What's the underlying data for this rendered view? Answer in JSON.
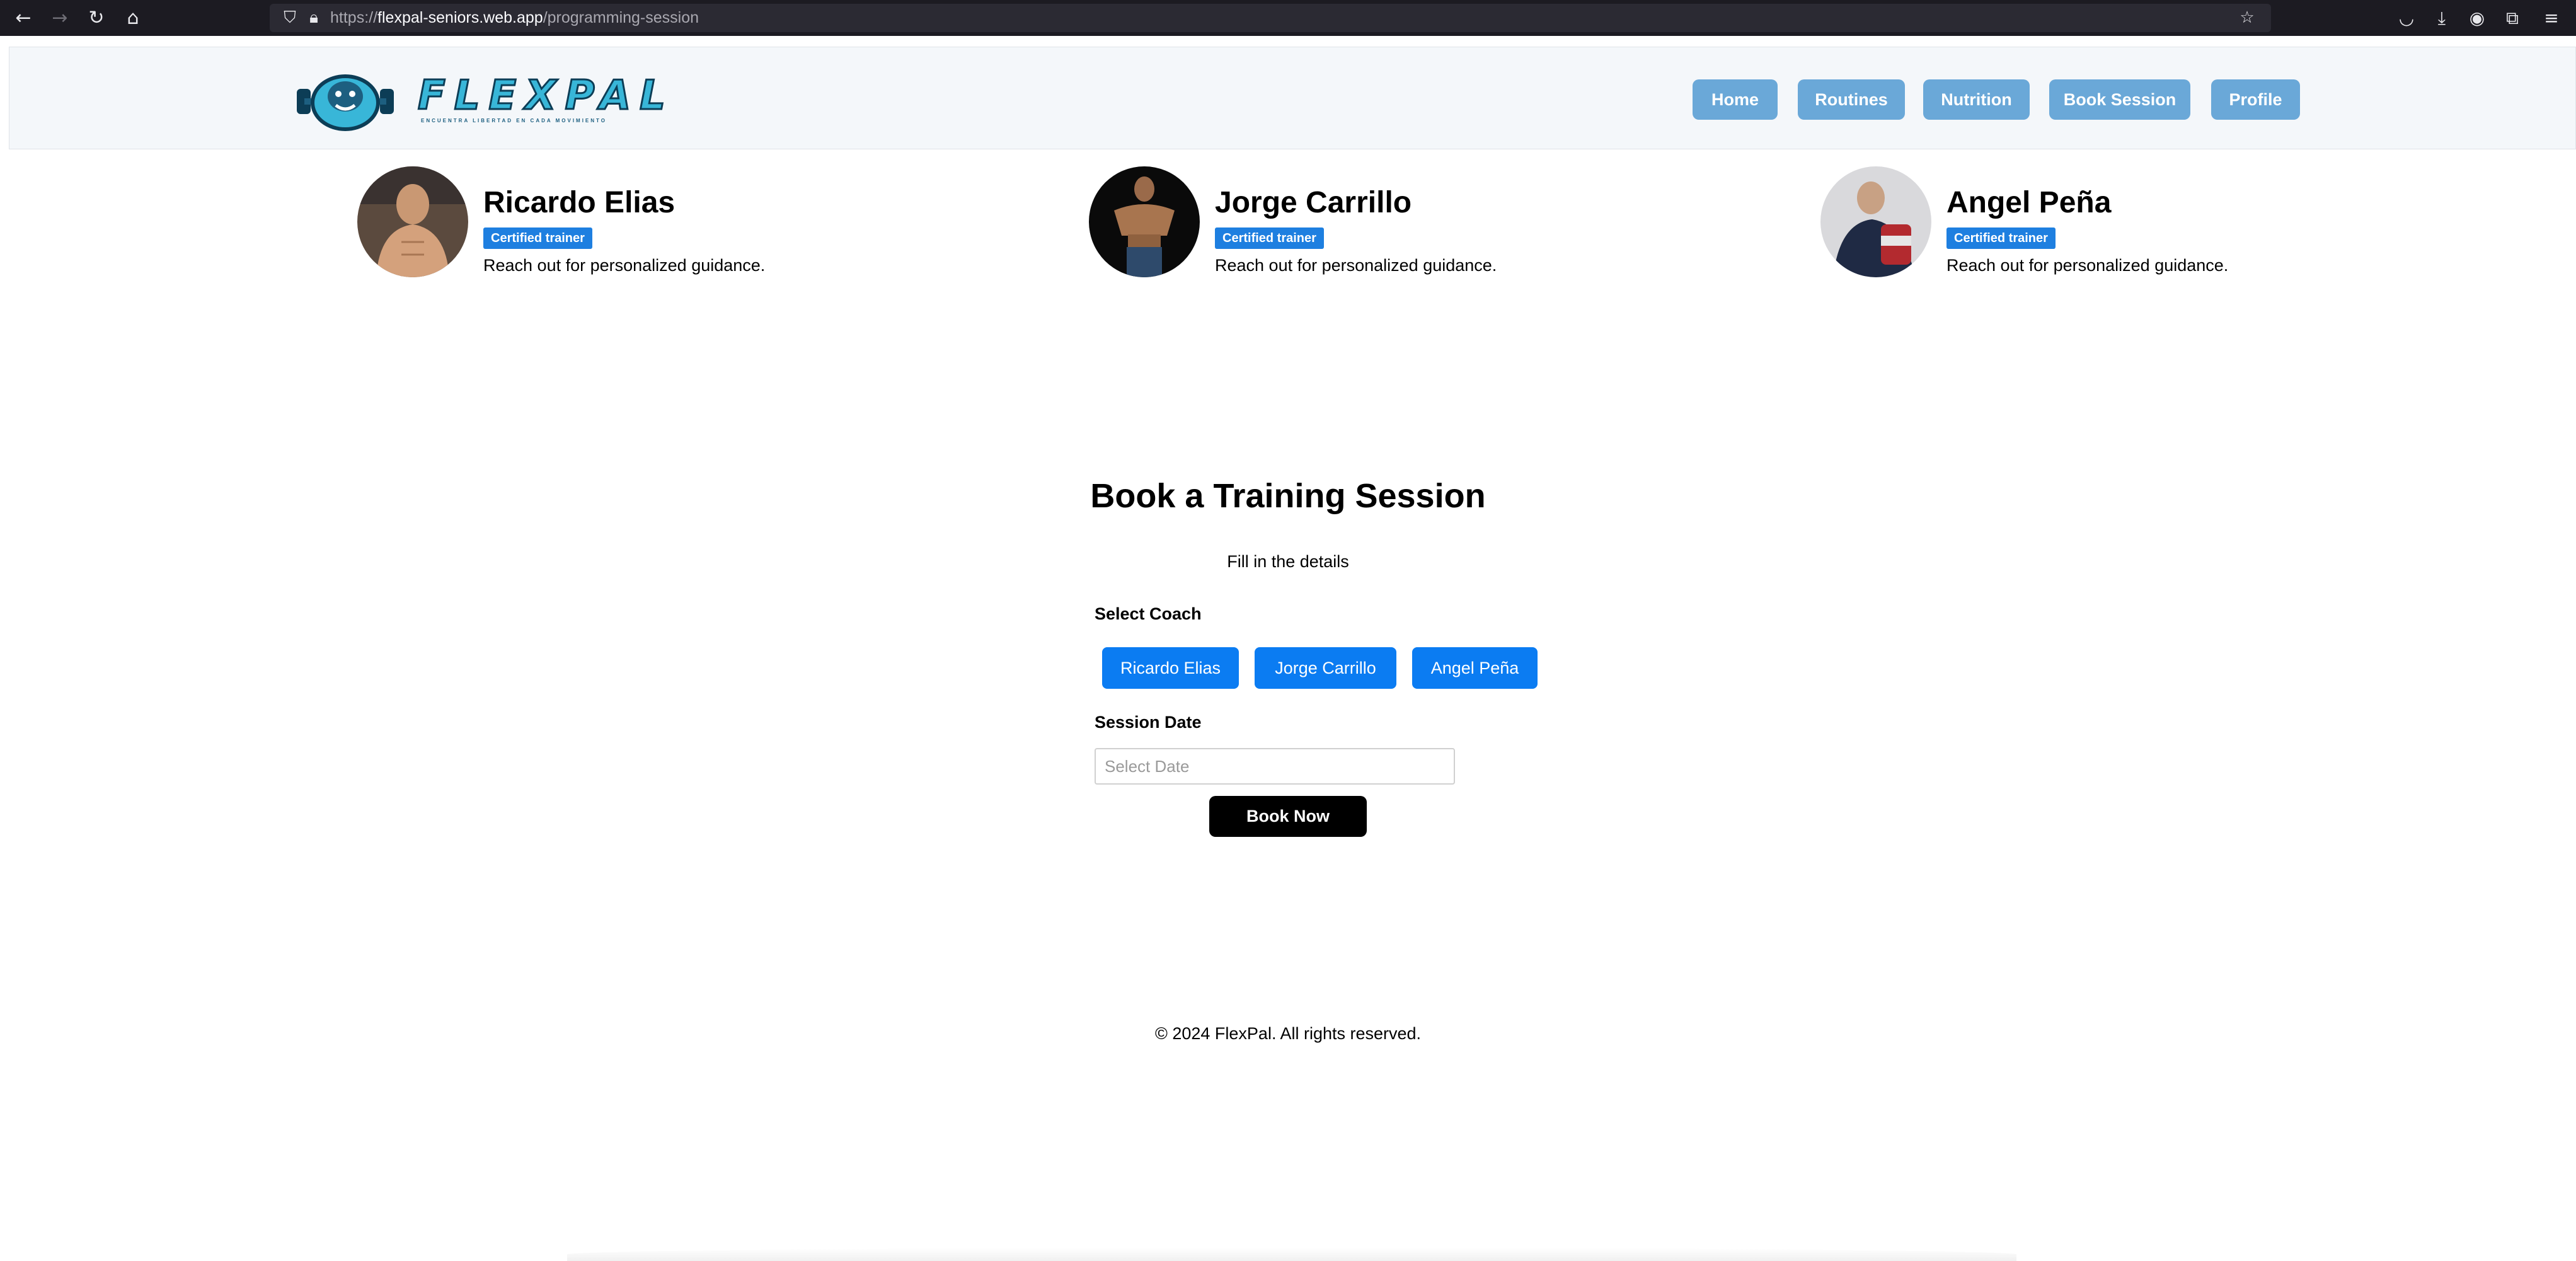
{
  "browser": {
    "url_prefix": "https://",
    "url_host": "flexpal-seniors.web.app",
    "url_path": "/programming-session",
    "icons": [
      "back-icon",
      "forward-icon",
      "reload-icon",
      "home-icon",
      "shield-icon",
      "lock-icon",
      "bookmark-star-icon",
      "pocket-icon",
      "download-icon",
      "account-icon",
      "extensions-icon",
      "menu-icon"
    ]
  },
  "header": {
    "logo_text": "FLEXPAL",
    "logo_tagline": "ENCUENTRA LIBERTAD EN CADA MOVIMIENTO",
    "nav": [
      {
        "label": "Home"
      },
      {
        "label": "Routines"
      },
      {
        "label": "Nutrition"
      },
      {
        "label": "Book Session"
      },
      {
        "label": "Profile"
      }
    ],
    "nav_color": "#6aa8d8"
  },
  "coaches": [
    {
      "name": "Ricardo Elias",
      "badge": "Certified trainer",
      "description": "Reach out for personalized guidance."
    },
    {
      "name": "Jorge Carrillo",
      "badge": "Certified trainer",
      "description": "Reach out for personalized guidance."
    },
    {
      "name": "Angel Peña",
      "badge": "Certified trainer",
      "description": "Reach out for personalized guidance."
    }
  ],
  "booking": {
    "title": "Book a Training Session",
    "subtitle": "Fill in the details",
    "select_coach_label": "Select Coach",
    "coach_options": [
      "Ricardo Elias",
      "Jorge Carrillo",
      "Angel Peña"
    ],
    "session_date_label": "Session Date",
    "date_placeholder": "Select Date",
    "submit_label": "Book Now",
    "accent_color": "#0b7cf2"
  },
  "footer": {
    "text": "© 2024 FlexPal. All rights reserved."
  }
}
